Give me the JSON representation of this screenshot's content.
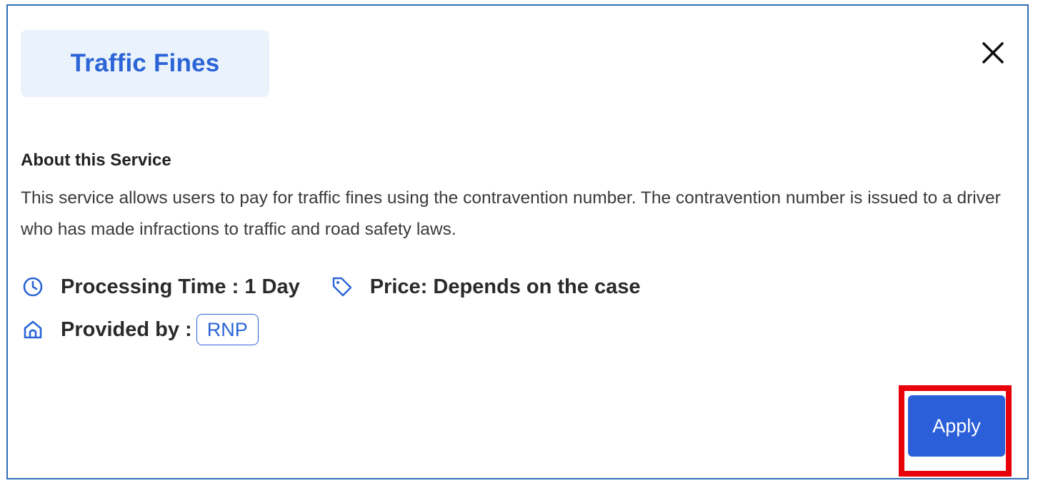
{
  "dialog": {
    "title": "Traffic Fines",
    "close_icon": "close-icon"
  },
  "about": {
    "heading": "About this Service",
    "body": "This service allows users to pay for traffic fines using the contravention number. The contravention number is issued to a driver who has made infractions to traffic and road safety laws."
  },
  "meta": {
    "processing_time": "Processing Time : 1 Day",
    "processing_icon": "clock-icon",
    "price": "Price: Depends on the case",
    "price_icon": "tag-icon",
    "provided_by_label": "Provided by :",
    "provided_by_icon": "home-icon",
    "provider": "RNP"
  },
  "actions": {
    "apply_label": "Apply"
  },
  "colors": {
    "accent": "#2b64d6",
    "button": "#2b5fd9",
    "title_chip_bg": "#eaf2fc",
    "frame_border": "#2f6db5",
    "highlight": "#e8000b"
  }
}
